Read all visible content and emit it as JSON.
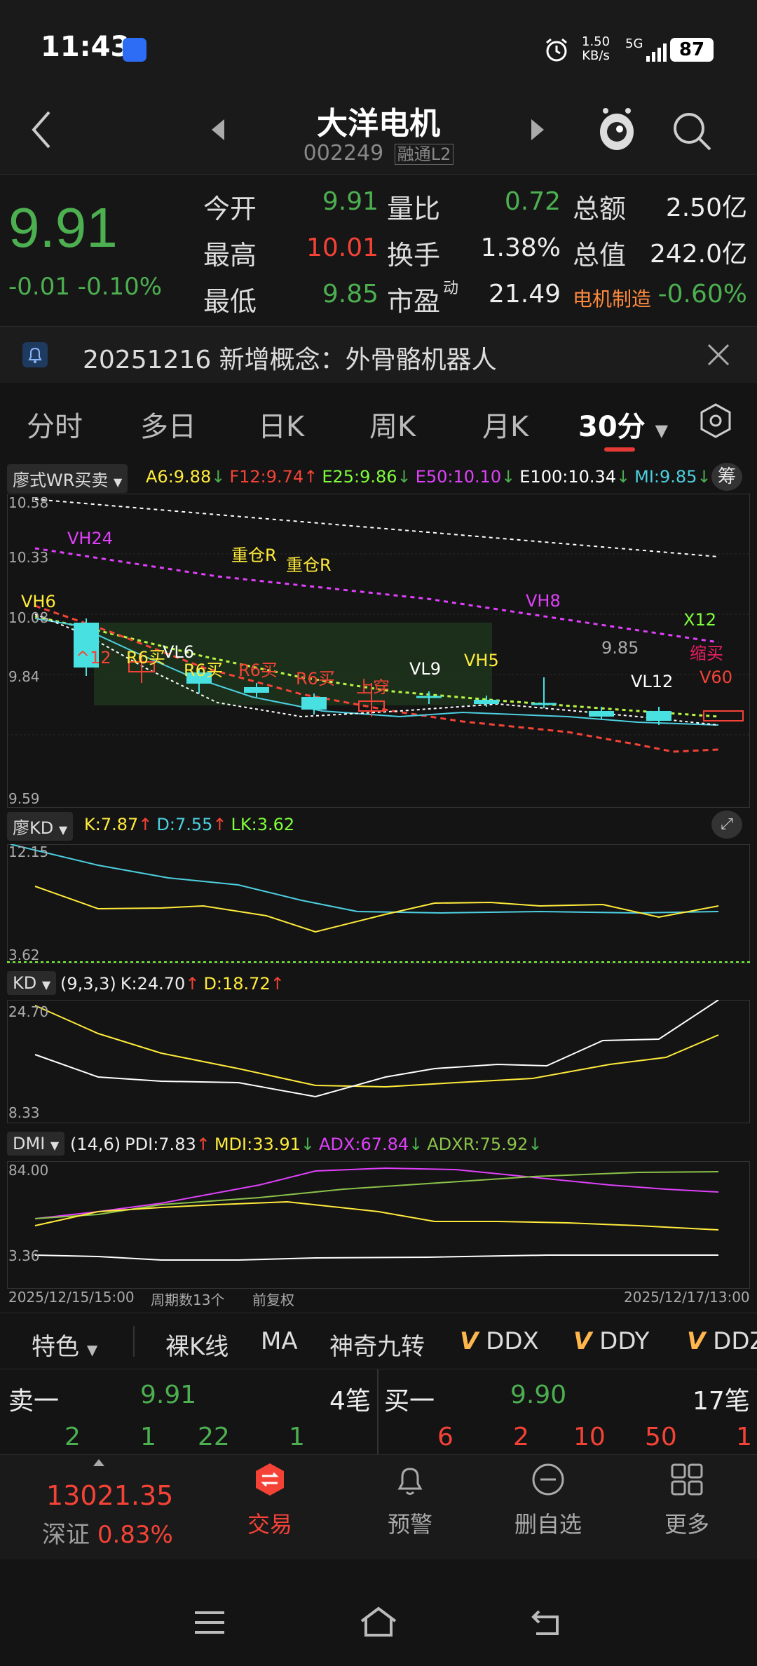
{
  "status": {
    "time": "11:43",
    "speed_value": "1.50",
    "speed_unit": "KB/s",
    "network": "5G",
    "battery": "87"
  },
  "header": {
    "title": "大洋电机",
    "code": "002249",
    "badges": "融通L2"
  },
  "quote": {
    "price": "9.91",
    "change": "-0.01",
    "change_pct": "-0.10%",
    "fields": [
      {
        "label": "今开",
        "value": "9.91",
        "color": "#4caf50"
      },
      {
        "label": "量比",
        "value": "0.72",
        "color": "#4caf50"
      },
      {
        "label": "总额",
        "value": "2.50亿",
        "color": "#eeeeee"
      },
      {
        "label": "最高",
        "value": "10.01",
        "color": "#f44336"
      },
      {
        "label": "换手",
        "value": "1.38%",
        "color": "#eeeeee"
      },
      {
        "label": "总值",
        "value": "242.0亿",
        "color": "#eeeeee"
      },
      {
        "label": "最低",
        "value": "9.85",
        "color": "#4caf50"
      },
      {
        "label": "市盈",
        "value": "21.49",
        "color": "#eeeeee"
      },
      {
        "label": "电机制造",
        "value": "-0.60%",
        "color": "#4caf50"
      }
    ],
    "pe_sup": "动"
  },
  "news": {
    "text": "20251216 新增概念：外骨骼机器人"
  },
  "tabs": [
    "分时",
    "多日",
    "日K",
    "周K",
    "月K",
    "30分"
  ],
  "main_chart": {
    "indicator": "廖式WR买卖",
    "legend": [
      {
        "text": "A6:9.88",
        "color": "#ffeb3b",
        "arrow": "↓",
        "arrow_color": "#4caf50"
      },
      {
        "text": "F12:9.74",
        "color": "#f44336",
        "arrow": "↑",
        "arrow_color": "#f44336"
      },
      {
        "text": "E25:9.86",
        "color": "#7fff3b",
        "arrow": "↓",
        "arrow_color": "#4caf50"
      },
      {
        "text": "E50:10.10",
        "color": "#e040fb",
        "arrow": "↓",
        "arrow_color": "#4caf50"
      },
      {
        "text": "E100:10.34",
        "color": "#ffffff",
        "arrow": "↓",
        "arrow_color": "#4caf50"
      },
      {
        "text": "MI:9.85",
        "color": "#4dd0e1",
        "arrow": "↓",
        "arrow_color": "#4caf50"
      }
    ],
    "corner_btn": "筹",
    "y_ticks": [
      "10.58",
      "10.33",
      "10.08",
      "9.84",
      "9.59"
    ],
    "annotations": [
      {
        "text": "VH24",
        "color": "#e040fb"
      },
      {
        "text": "重仓R",
        "color": "#ffeb3b"
      },
      {
        "text": "重仓R",
        "color": "#ffeb3b"
      },
      {
        "text": "VH6",
        "color": "#ffeb3b"
      },
      {
        "text": "VH8",
        "color": "#e040fb"
      },
      {
        "text": "X12",
        "color": "#7fff3b"
      },
      {
        "text": "^12",
        "color": "#f44336"
      },
      {
        "text": "R6买",
        "color": "#ffeb3b"
      },
      {
        "text": "VL6",
        "color": "#ffffff"
      },
      {
        "text": "R6买",
        "color": "#ffeb3b"
      },
      {
        "text": "R6买",
        "color": "#f44336"
      },
      {
        "text": "R6买",
        "color": "#f44336"
      },
      {
        "text": "VL9",
        "color": "#ffffff"
      },
      {
        "text": "VH5",
        "color": "#ffeb3b"
      },
      {
        "text": "上穿",
        "color": "#f44336"
      },
      {
        "text": "9.85",
        "color": "#aaaaaa"
      },
      {
        "text": "缩买",
        "color": "#e91e63"
      },
      {
        "text": "VL12",
        "color": "#ffffff"
      },
      {
        "text": "V60",
        "color": "#f44336"
      }
    ]
  },
  "kd_panel": {
    "indicator": "廖KD",
    "legend": [
      {
        "text": "K:7.87",
        "color": "#ffeb3b",
        "arrow": "↑",
        "arrow_color": "#f44336"
      },
      {
        "text": "D:7.55",
        "color": "#4dd0e1",
        "arrow": "↑",
        "arrow_color": "#f44336"
      },
      {
        "text": "LK:3.62",
        "color": "#7fff3b",
        "arrow": "",
        "arrow_color": "#7fff3b"
      }
    ],
    "y_ticks": [
      "12.15",
      "3.62"
    ]
  },
  "kd2_panel": {
    "indicator": "KD",
    "legend": [
      {
        "text": "(9,3,3)",
        "color": "#eeeeee",
        "arrow": "",
        "arrow_color": "#eeeeee"
      },
      {
        "text": "K:24.70",
        "color": "#eeeeee",
        "arrow": "↑",
        "arrow_color": "#f44336"
      },
      {
        "text": "D:18.72",
        "color": "#ffeb3b",
        "arrow": "↑",
        "arrow_color": "#f44336"
      }
    ],
    "y_ticks": [
      "24.70",
      "8.33"
    ]
  },
  "dmi_panel": {
    "indicator": "DMI",
    "legend": [
      {
        "text": "(14,6)",
        "color": "#eeeeee",
        "arrow": "",
        "arrow_color": "#eeeeee"
      },
      {
        "text": "PDI:7.83",
        "color": "#eeeeee",
        "arrow": "↑",
        "arrow_color": "#f44336"
      },
      {
        "text": "MDI:33.91",
        "color": "#ffeb3b",
        "arrow": "↓",
        "arrow_color": "#4caf50"
      },
      {
        "text": "ADX:67.84",
        "color": "#e040fb",
        "arrow": "↓",
        "arrow_color": "#4caf50"
      },
      {
        "text": "ADXR:75.92",
        "color": "#8bc34a",
        "arrow": "↓",
        "arrow_color": "#4caf50"
      }
    ],
    "y_ticks": [
      "84.00",
      "3.36"
    ]
  },
  "footer_chart": {
    "start_date": "2025/12/15/15:00",
    "period_count": "周期数13个",
    "adjust": "前复权",
    "end_date": "2025/12/17/13:00"
  },
  "toolbar": [
    "特色",
    "裸K线",
    "MA",
    "神奇九转",
    "DDX",
    "DDY",
    "DDZ"
  ],
  "book": {
    "sell_label": "卖一",
    "sell_price": "9.91",
    "sell_count": "4笔",
    "buy_label": "买一",
    "buy_price": "9.90",
    "buy_count": "17笔",
    "sell_queue": [
      "2",
      "1",
      "22",
      "1"
    ],
    "buy_queue": [
      "6",
      "2",
      "10",
      "50",
      "1"
    ]
  },
  "bottom_nav": {
    "index_value": "13021.35",
    "index_name": "深证",
    "index_pct": "0.83%",
    "items": [
      "交易",
      "预警",
      "删自选",
      "更多"
    ]
  }
}
